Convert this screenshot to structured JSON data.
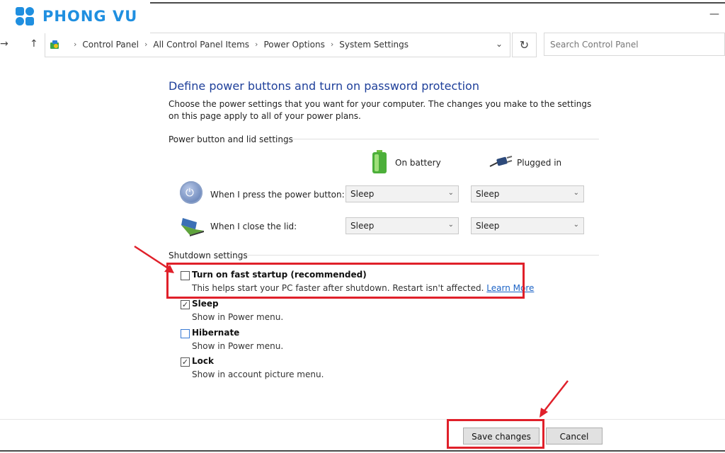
{
  "brand": {
    "logo_text": "PHONG VU",
    "color": "#1f8fe0"
  },
  "window": {
    "minimize": "—"
  },
  "address": {
    "crumbs": [
      "Control Panel",
      "All Control Panel Items",
      "Power Options",
      "System Settings"
    ],
    "search_placeholder": "Search Control Panel"
  },
  "page": {
    "title": "Define power buttons and turn on password protection",
    "description": "Choose the power settings that you want for your computer. The changes you make to the settings on this page apply to all of your power plans."
  },
  "power_section": {
    "header": "Power button and lid settings",
    "col_battery": "On battery",
    "col_plugged": "Plugged in",
    "rows": [
      {
        "label": "When I press the power button:",
        "battery": "Sleep",
        "plugged": "Sleep"
      },
      {
        "label": "When I close the lid:",
        "battery": "Sleep",
        "plugged": "Sleep"
      }
    ]
  },
  "shutdown_section": {
    "header": "Shutdown settings",
    "options": [
      {
        "title": "Turn on fast startup (recommended)",
        "desc": "This helps start your PC faster after shutdown. Restart isn't affected.",
        "link": "Learn More",
        "checked": false
      },
      {
        "title": "Sleep",
        "desc": "Show in Power menu.",
        "checked": true
      },
      {
        "title": "Hibernate",
        "desc": "Show in Power menu.",
        "checked": false
      },
      {
        "title": "Lock",
        "desc": "Show in account picture menu.",
        "checked": true
      }
    ]
  },
  "buttons": {
    "save": "Save changes",
    "cancel": "Cancel"
  },
  "colors": {
    "highlight": "#e0202a",
    "title": "#1e3f9a",
    "link": "#1c63c6"
  }
}
